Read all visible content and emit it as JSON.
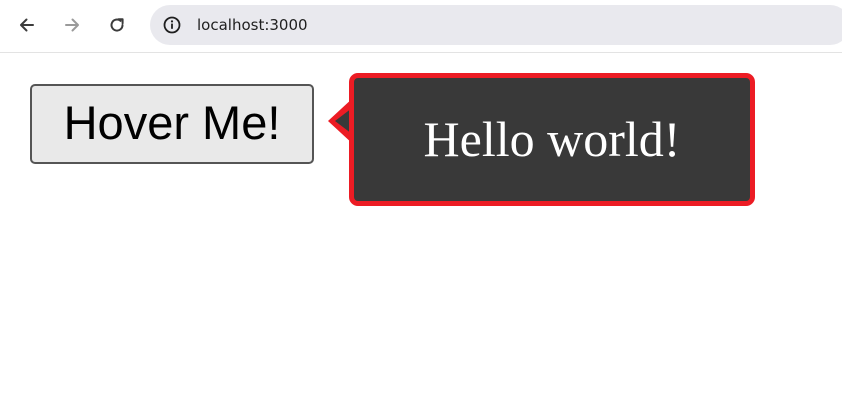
{
  "browser": {
    "url": "localhost:3000",
    "icons": {
      "back": "arrow-left-icon",
      "forward": "arrow-right-icon",
      "reload": "reload-icon",
      "site_info": "info-icon"
    }
  },
  "page": {
    "button_label": "Hover Me!",
    "tooltip_text": "Hello world!"
  },
  "colors": {
    "tooltip_background": "#393939",
    "tooltip_border": "#ec1c24",
    "button_background": "#e9e9e9",
    "button_border": "#555555"
  }
}
